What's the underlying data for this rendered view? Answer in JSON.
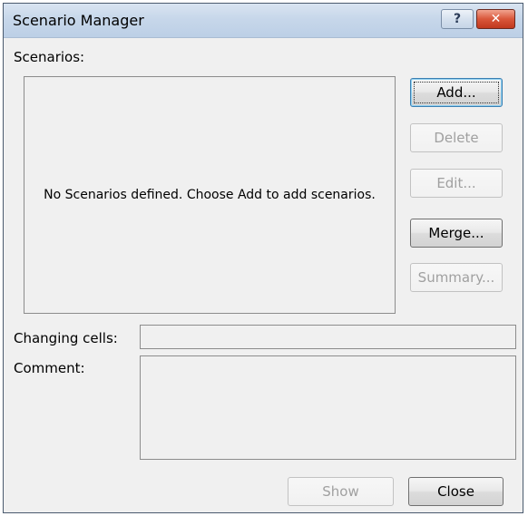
{
  "window": {
    "title": "Scenario Manager",
    "help_glyph": "?",
    "close_glyph": "✕"
  },
  "scenarios": {
    "label": "Scenarios:",
    "empty_message": "No Scenarios defined. Choose Add to add scenarios."
  },
  "buttons": {
    "add": "Add...",
    "delete": "Delete",
    "edit": "Edit...",
    "merge": "Merge...",
    "summary": "Summary...",
    "show": "Show",
    "close": "Close"
  },
  "fields": {
    "changing_cells_label": "Changing cells:",
    "changing_cells_value": "",
    "comment_label": "Comment:",
    "comment_value": ""
  }
}
